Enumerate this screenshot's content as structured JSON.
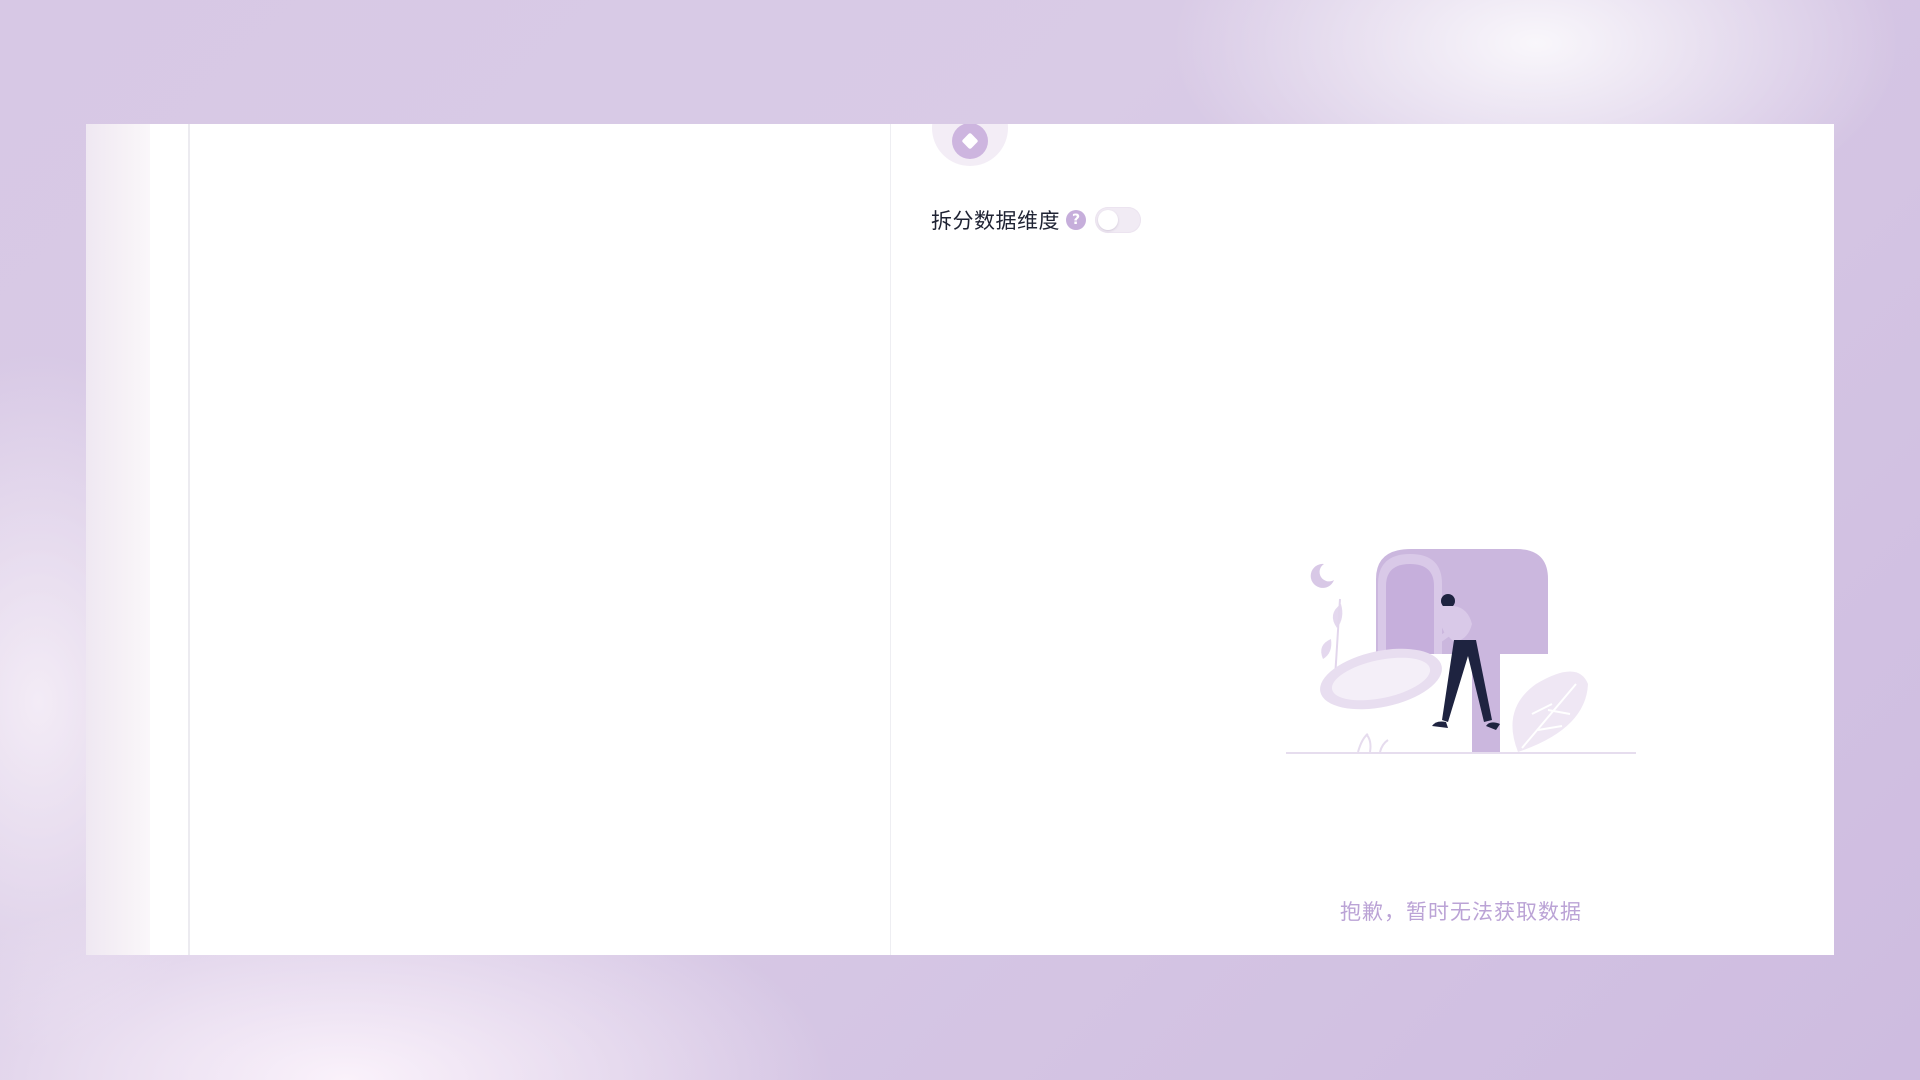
{
  "settings": {
    "split_dimension_label": "拆分数据维度",
    "help_icon": "question-circle-icon",
    "split_toggle_on": false
  },
  "empty_state": {
    "message": "抱歉，暂时无法获取数据",
    "illustration": "mailbox-person-illustration"
  },
  "colors": {
    "accent": "#c6aedb",
    "empty_text": "#bba3d6",
    "background": "#d7c8e5"
  }
}
